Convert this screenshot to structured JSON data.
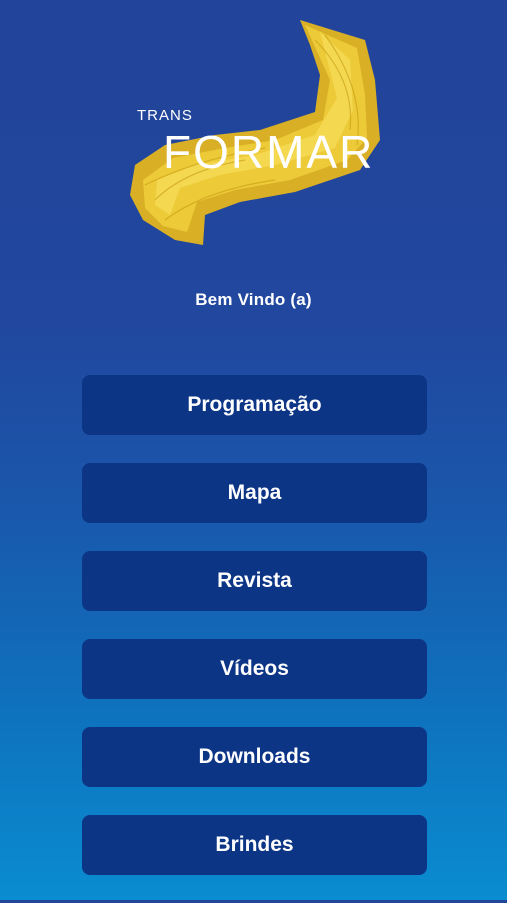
{
  "logo": {
    "line1": "TRANS",
    "line2": "FORMAR",
    "accent_color": "#e8c22a"
  },
  "welcome": "Bem Vindo (a)",
  "menu": [
    {
      "label": "Programação",
      "icon": ""
    },
    {
      "label": "Mapa",
      "icon": ""
    },
    {
      "label": "Revista",
      "icon": ""
    },
    {
      "label": "Vídeos",
      "icon": ""
    },
    {
      "label": "Downloads",
      "icon": ""
    },
    {
      "label": "Brindes",
      "icon": ""
    }
  ],
  "colors": {
    "background_top": "#22449a",
    "background_bottom": "#0a8cd0",
    "button": "#0d3585",
    "text": "#ffffff"
  }
}
